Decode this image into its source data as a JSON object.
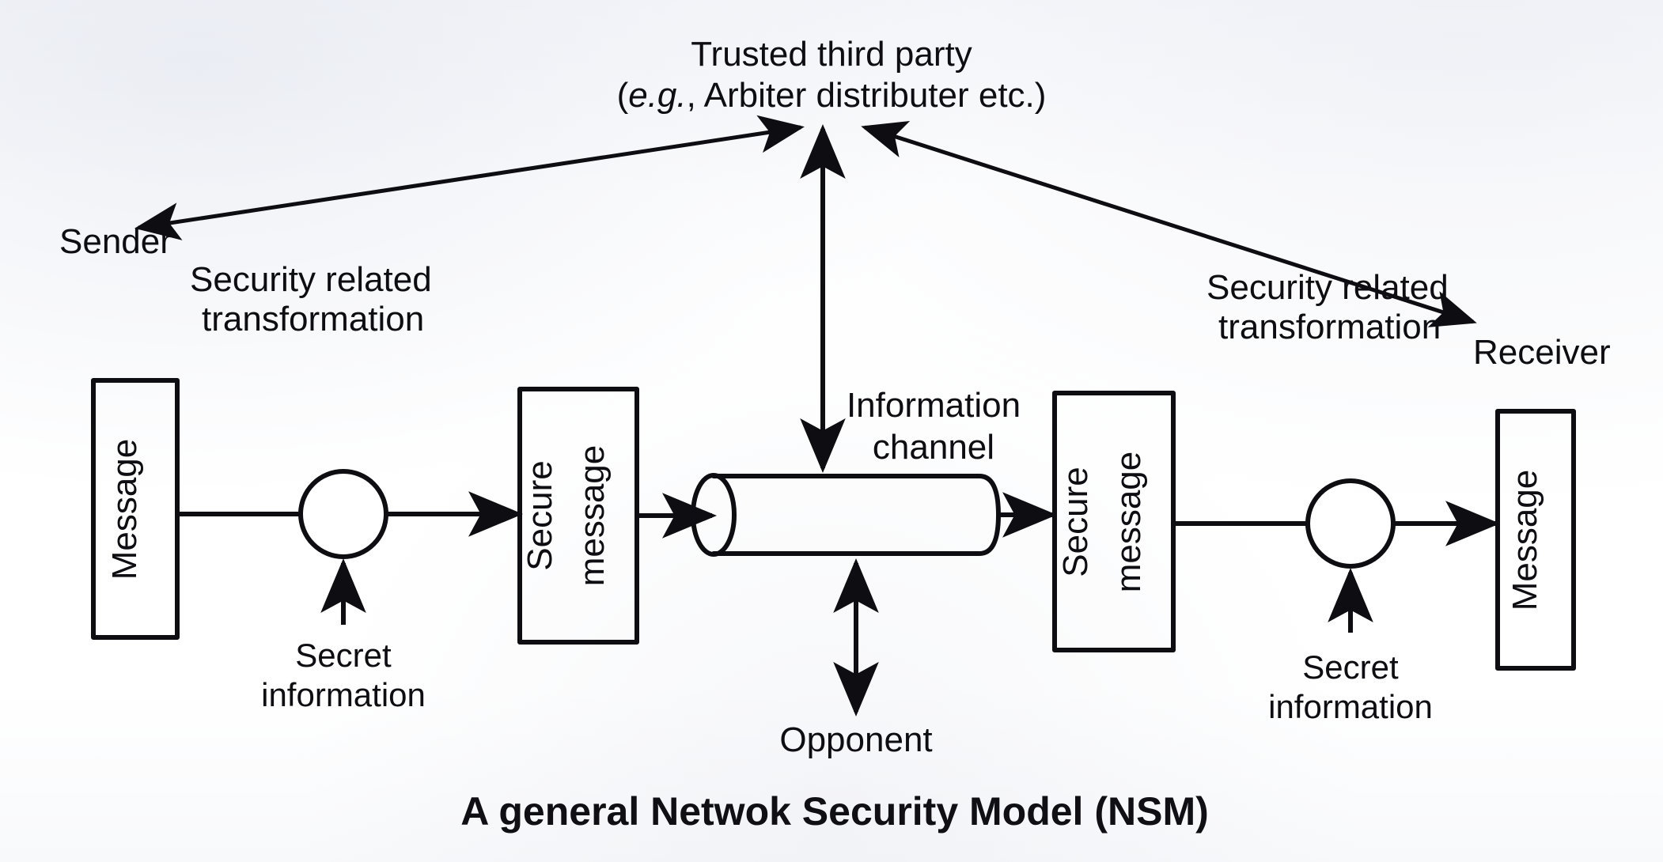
{
  "figure": {
    "caption": "A general Netwok Security Model (NSM)",
    "top_party": {
      "line1": "Trusted third party",
      "line2_prefix": "(",
      "line2_italic": "e.g.",
      "line2_suffix": ", Arbiter distributer etc.)"
    },
    "endpoints": {
      "sender_label": "Sender",
      "receiver_label": "Receiver"
    },
    "left_side": {
      "message_box": "Message",
      "transformation_line1": "Security related",
      "transformation_line2": "transformation",
      "secure_box_line1": "Secure",
      "secure_box_line2": "message",
      "secret_line1": "Secret",
      "secret_line2": "information"
    },
    "right_side": {
      "message_box": "Message",
      "transformation_line1": "Security related",
      "transformation_line2": "transformation",
      "secure_box_line1": "Secure",
      "secure_box_line2": "message",
      "secret_line1": "Secret",
      "secret_line2": "information"
    },
    "channel": {
      "label_line1": "Information",
      "label_line2": "channel"
    },
    "threat": {
      "label": "Opponent"
    },
    "colors": {
      "ink": "#0d0d12",
      "paper": "#fbfbfc"
    }
  }
}
